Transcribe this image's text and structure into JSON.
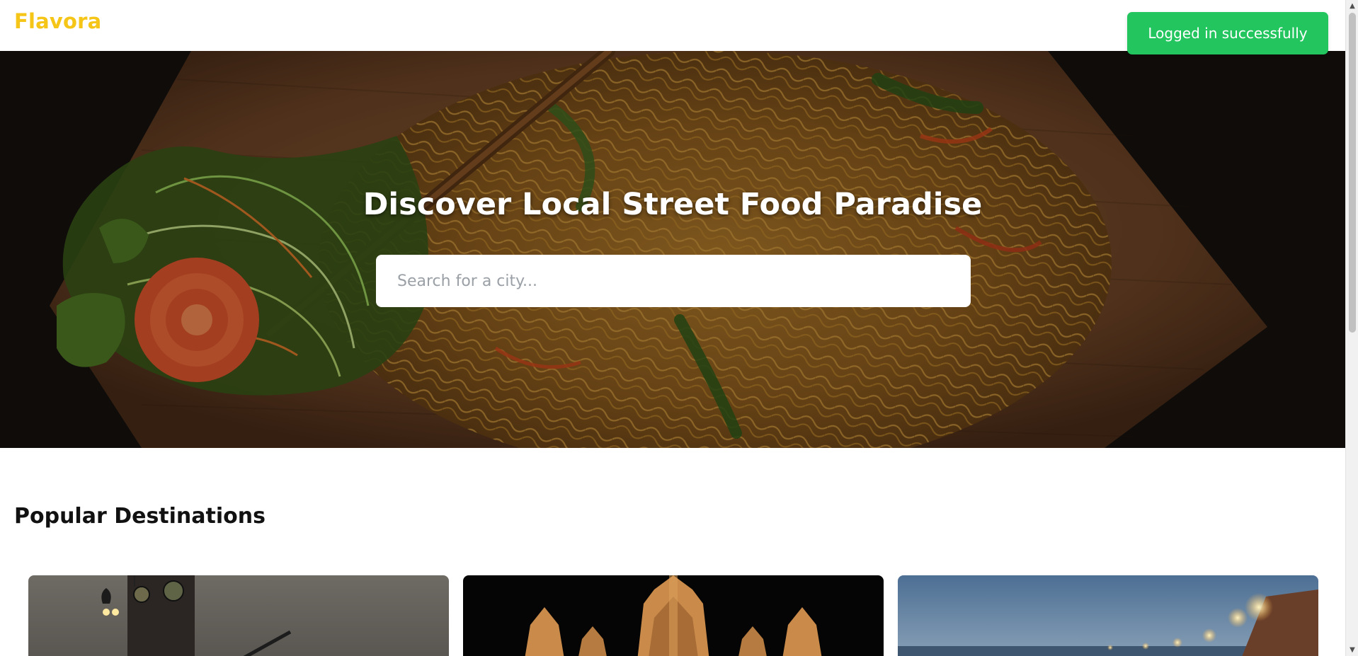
{
  "header": {
    "brand": "Flavora"
  },
  "toast": {
    "message": "Logged in successfully"
  },
  "hero": {
    "title": "Discover Local Street Food Paradise",
    "search": {
      "placeholder": "Search for a city...",
      "value": ""
    }
  },
  "popular": {
    "title": "Popular Destinations",
    "cards": [
      {
        "image": "city-clock-tower-dusk"
      },
      {
        "image": "temple-night"
      },
      {
        "image": "riverside-evening-lights"
      }
    ]
  },
  "colors": {
    "brand": "#F5C518",
    "toast": "#22C55E",
    "title": "#111111"
  }
}
